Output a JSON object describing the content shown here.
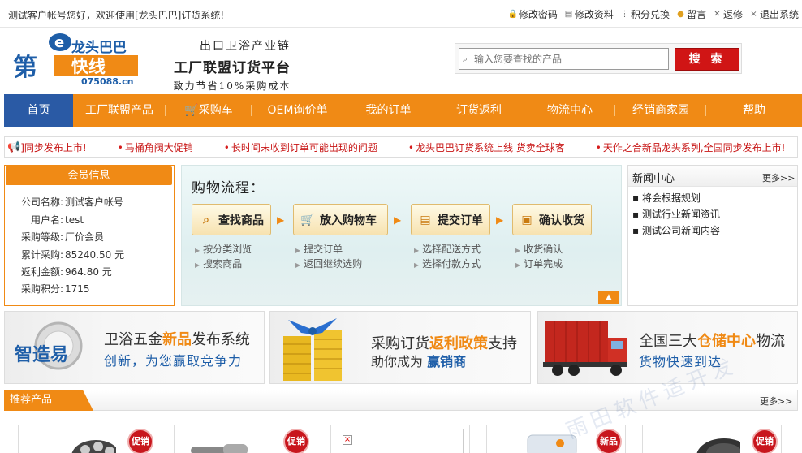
{
  "topbar": {
    "welcome": "测试客户帐号您好，欢迎使用[龙头巴巴]订货系统!",
    "links": [
      {
        "label": "修改密码",
        "icon": "lock-icon"
      },
      {
        "label": "修改资料",
        "icon": "profile-icon"
      },
      {
        "label": "积分兑换",
        "icon": "grid-icon"
      },
      {
        "label": "留言",
        "icon": "message-icon"
      },
      {
        "label": "返修",
        "icon": "wrench-icon"
      },
      {
        "label": "退出系统",
        "icon": "close-icon"
      }
    ]
  },
  "logo": {
    "brand": "龙头巴巴",
    "sub": "快线",
    "domain": "075088.cn",
    "prefix": "第",
    "letter": "e"
  },
  "slogan": {
    "line1": "出口卫浴产业链",
    "line2": "工厂联盟订货平台",
    "line3": "致力节省10%采购成本"
  },
  "search": {
    "placeholder": "输入您要查找的产品",
    "button": "搜 索"
  },
  "nav": [
    {
      "label": "首页",
      "active": true
    },
    {
      "label": "工厂联盟产品"
    },
    {
      "label": "采购车",
      "icon": "cart-icon"
    },
    {
      "label": "OEM询价单"
    },
    {
      "label": "我的订单"
    },
    {
      "label": "订货返利"
    },
    {
      "label": "物流中心"
    },
    {
      "label": "经销商家园"
    },
    {
      "label": "帮助"
    }
  ],
  "ticker": [
    "]同步发布上市!",
    "马桶角阀大促销",
    "长时间未收到订单可能出现的问题",
    "龙头巴巴订货系统上线 货卖全球客",
    "天作之合新品龙头系列,全国同步发布上市!"
  ],
  "member": {
    "title": "会员信息",
    "rows": [
      {
        "label": "公司名称:",
        "value": "测试客户帐号"
      },
      {
        "label": "用户名:",
        "value": "test"
      },
      {
        "label": "采购等级:",
        "value": "厂价会员"
      },
      {
        "label": "累计采购:",
        "value": "85240.50 元"
      },
      {
        "label": "返利金额:",
        "value": "964.80 元"
      },
      {
        "label": "采购积分:",
        "value": "1715"
      }
    ]
  },
  "flow": {
    "title": "购物流程：",
    "steps": [
      {
        "label": "查找商品",
        "icon": "search-icon",
        "subs": [
          "按分类浏览",
          "搜索商品"
        ]
      },
      {
        "label": "放入购物车",
        "icon": "cart-icon",
        "subs": [
          "提交订单",
          "返回继续选购"
        ]
      },
      {
        "label": "提交订单",
        "icon": "document-icon",
        "subs": [
          "选择配送方式",
          "选择付款方式"
        ]
      },
      {
        "label": "确认收货",
        "icon": "box-icon",
        "subs": [
          "收货确认",
          "订单完成"
        ]
      }
    ]
  },
  "news": {
    "title": "新闻中心",
    "more": "更多>>",
    "items": [
      "将会根据规划",
      "测试行业新闻资讯",
      "测试公司新闻内容"
    ]
  },
  "banners": [
    {
      "logo": "智造易",
      "t1a": "卫浴五金",
      "t1b": "新品",
      "t1c": "发布系统",
      "t2": "创新，为您赢取竞争力"
    },
    {
      "t1a": "采购订货",
      "t1b": "返利政策",
      "t1c": "支持",
      "t2a": "助你成为",
      "t2b": "赢销商"
    },
    {
      "t1a": "全国三大",
      "t1b": "仓储中心",
      "t1c": "物流",
      "t2": "货物快速到达"
    }
  ],
  "recommend": {
    "title": "推荐产品",
    "more": "更多>>",
    "badges": [
      "促销",
      "促销",
      "",
      "新品",
      "促销"
    ]
  },
  "watermark": "雨田软件适开发"
}
